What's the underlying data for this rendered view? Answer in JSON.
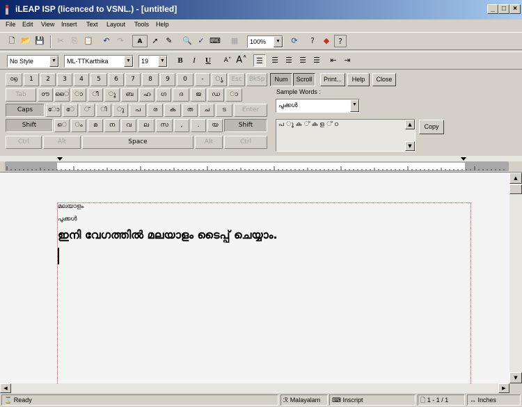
{
  "window": {
    "title": "iLEAP ISP (licenced to VSNL.) - [untitled]",
    "minimize": "_",
    "maximize": "□",
    "close": "×"
  },
  "menu": [
    "File",
    "Edit",
    "View",
    "Insert",
    "Text",
    "Layout",
    "Tools",
    "Help"
  ],
  "toolbar": {
    "zoom": "100%",
    "font_spacing_label": "A",
    "style": "No Style",
    "font": "ML-TTKarthika",
    "size": "19",
    "bold": "B",
    "italic": "I",
    "underline": "U"
  },
  "keyboard": {
    "row1": [
      "൦൭",
      "1",
      "2",
      "3",
      "4",
      "5",
      "6",
      "7",
      "8",
      "9",
      "0",
      "-",
      "ൃ"
    ],
    "row1_dis": [
      "Esc",
      "BkSp"
    ],
    "row2_tab": "Tab",
    "row2": [
      "൦ൗ",
      "ൈ",
      "ാ",
      "ീ",
      "ൂ",
      "ബ",
      "ഹ",
      "ഗ",
      "ദ",
      "ജ",
      "ഡ",
      "ാ"
    ],
    "row3_caps": "Caps",
    "row3": [
      "ോ",
      "േ",
      "്",
      "ി",
      "ു",
      "പ",
      "ര",
      "ക",
      "ത",
      "ച",
      "ട"
    ],
    "row3_enter": "Enter",
    "row4_shift": "Shift",
    "row4": [
      "െ",
      "ം",
      "മ",
      "ന",
      "വ",
      "ല",
      "സ",
      ",",
      ".",
      "യ"
    ],
    "row5": {
      "ctrl": "Ctrl",
      "alt": "Alt",
      "space": "Space"
    },
    "num": "Num",
    "scroll": "Scroll",
    "print": "Print...",
    "help": "Help",
    "close": "Close"
  },
  "sample": {
    "label": "Sample Words :",
    "word": "പൂക്കൾ",
    "letters": "പ ൂ ക ് ക ള ് ഠ",
    "copy": "Copy"
  },
  "document": {
    "line1": "മലയാളം",
    "line2": "പൂക്കൾ",
    "line3": "ഇനി വേഗത്തിൽ മലയാളം ടൈപ്പ് ചെയ്യാം."
  },
  "status": {
    "ready": "Ready",
    "language": "Malayalam",
    "layout": "Inscript",
    "page": "1 - 1 / 1",
    "units": "Inches"
  }
}
